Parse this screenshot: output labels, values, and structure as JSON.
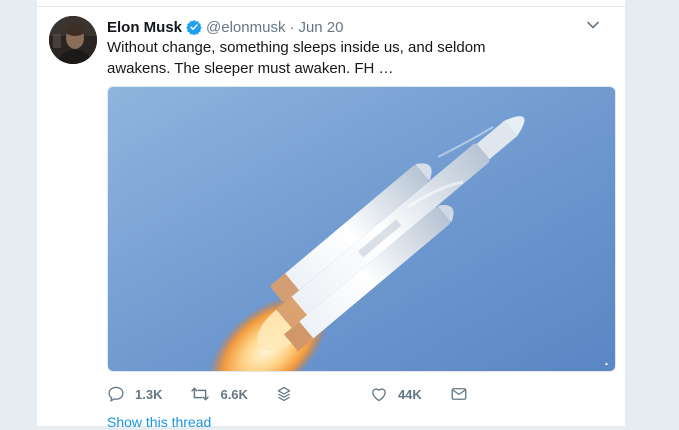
{
  "tweet": {
    "author_name": "Elon Musk",
    "author_handle": "@elonmusk",
    "separator": "·",
    "date": "Jun 20",
    "text": "Without change, something sleeps inside us, and seldom awakens. The sleeper must awaken. FH …",
    "media": {
      "subject": "Falcon Heavy rocket launch"
    },
    "actions": {
      "replies": "1.3K",
      "retweets": "6.6K",
      "likes": "44K"
    },
    "show_thread": "Show this thread"
  },
  "colors": {
    "background": "#e6ecf0",
    "card": "#ffffff",
    "link": "#1b95e0",
    "verified": "#1da1f2",
    "muted": "#657786",
    "text": "#14171a"
  },
  "icons": [
    "verified-badge-icon",
    "chevron-down-icon",
    "reply-icon",
    "retweet-icon",
    "stack-icon",
    "heart-icon",
    "message-icon"
  ]
}
